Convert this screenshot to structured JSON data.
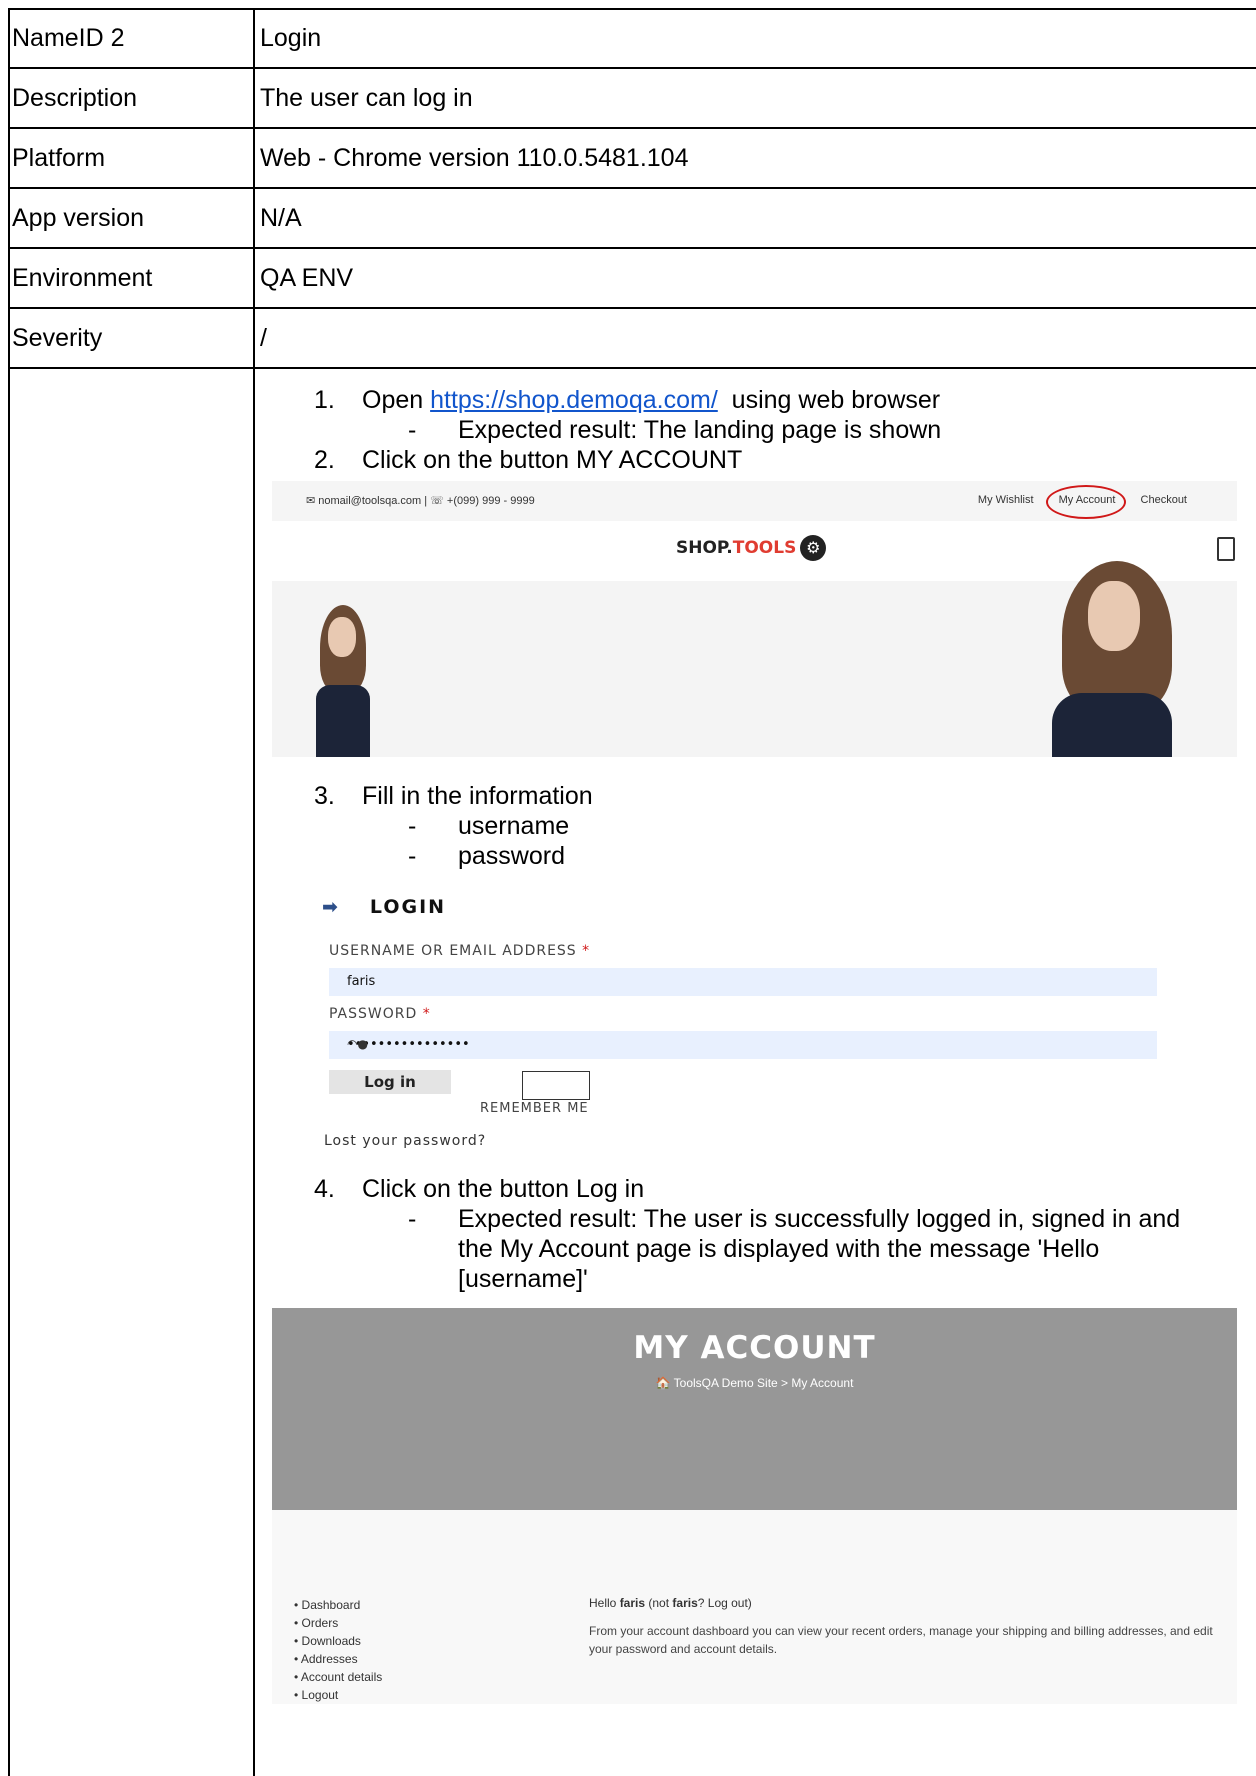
{
  "rows": [
    {
      "label": "NameID 2",
      "value": "Login"
    },
    {
      "label": "Description",
      "value": "The user can log in"
    },
    {
      "label": "Platform",
      "value": "Web - Chrome version 110.0.5481.104"
    },
    {
      "label": "App version",
      "value": "N/A"
    },
    {
      "label": "Environment",
      "value": "QA ENV"
    },
    {
      "label": "Severity",
      "value": "/"
    }
  ],
  "steps": {
    "s1_num": "1.",
    "s1_text_a": "Open ",
    "s1_link": "https://shop.demoqa.com/",
    "s1_text_b": "  using web browser",
    "s1_dash": "-",
    "s1_expected": "Expected result: The landing page is shown",
    "s2_num": "2.",
    "s2_text": "Click on the button MY ACCOUNT",
    "s3_num": "3.",
    "s3_text": "Fill in the information",
    "s3_a": "username",
    "s3_b": "password",
    "s4_num": "4.",
    "s4_text": "Click on the button Log in",
    "s4_expected_1": "Expected result: The user is successfully logged in, signed in and",
    "s4_expected_2": "the My Account page is displayed with the message 'Hello",
    "s4_expected_3": "[username]'"
  },
  "shop": {
    "contact": "✉ nomail@toolsqa.com  |  ☏ +(099) 999 - 9999",
    "nav": [
      "My Wishlist",
      "My Account",
      "Checkout"
    ],
    "logo_a": "SHOP.",
    "logo_b": "TOOLS"
  },
  "login": {
    "title": "LOGIN",
    "username_label": "USERNAME OR EMAIL ADDRESS",
    "username_value": "faris",
    "password_label": "PASSWORD",
    "password_value": "••••••••••••••••",
    "button": "Log in",
    "remember": "REMEMBER ME",
    "lost": "Lost your password?"
  },
  "account": {
    "title": "MY ACCOUNT",
    "breadcrumb": "🏠  ToolsQA Demo Site  >  My Account",
    "menu": [
      "Dashboard",
      "Orders",
      "Downloads",
      "Addresses",
      "Account details",
      "Logout"
    ],
    "hello_prefix": "Hello ",
    "hello_name": "faris",
    "hello_mid": " (not ",
    "hello_name2": "faris",
    "hello_suffix": "? Log out)",
    "dashboard_text": "From your account dashboard you can view your recent orders, manage your shipping and billing addresses, and edit your password and account details."
  }
}
